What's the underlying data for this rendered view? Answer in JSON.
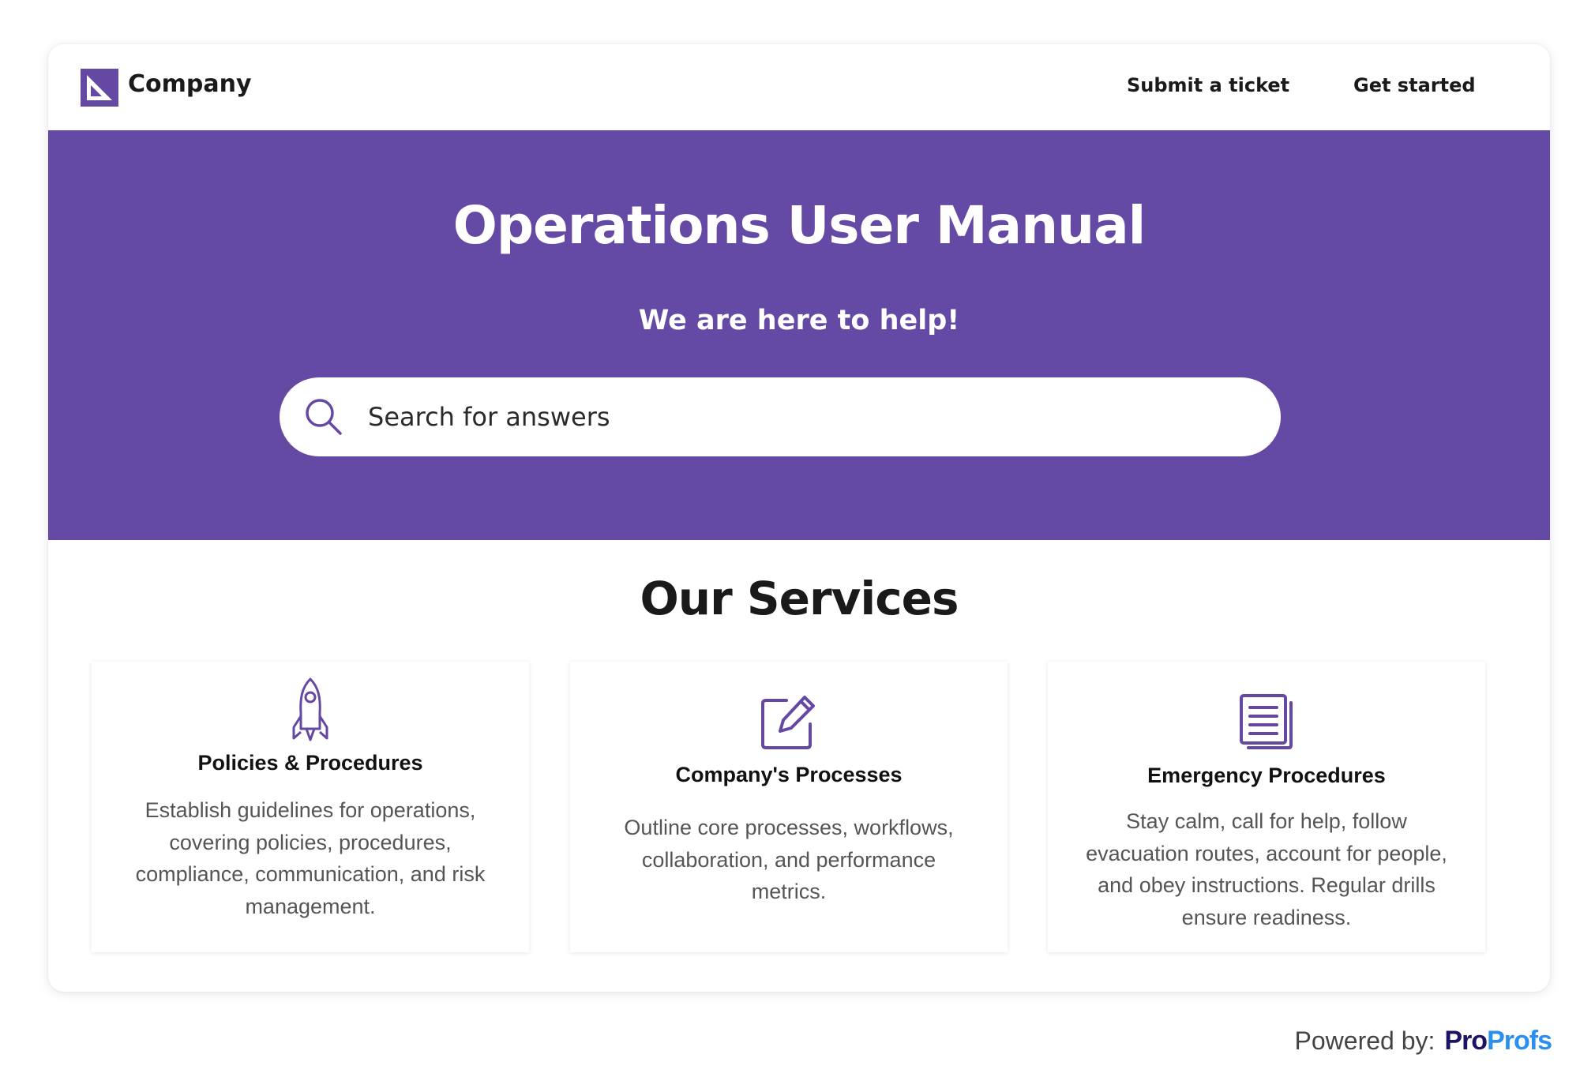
{
  "header": {
    "brand": "Company",
    "logo_icon": "company-logo-icon",
    "nav": [
      {
        "label": "Submit a ticket"
      },
      {
        "label": "Get started"
      }
    ]
  },
  "hero": {
    "title": "Operations User Manual",
    "subtitle": "We are here to help!",
    "search": {
      "placeholder": "Search for answers",
      "value": "",
      "icon": "search-icon"
    }
  },
  "services": {
    "title": "Our Services",
    "cards": [
      {
        "icon": "rocket-icon",
        "title": "Policies & Procedures",
        "description": "Establish guidelines for operations, covering policies, procedures, compliance, communication, and risk management."
      },
      {
        "icon": "edit-pencil-icon",
        "title": "Company's Processes",
        "description": "Outline core processes, workflows, collaboration, and performance metrics."
      },
      {
        "icon": "document-icon",
        "title": "Emergency Procedures",
        "description": "Stay calm, call for help, follow evacuation routes, account for people, and obey instructions. Regular drills ensure readiness."
      }
    ]
  },
  "footer": {
    "powered_label": "Powered by:",
    "brand_part1": "Pro",
    "brand_part2": "Profs"
  },
  "colors": {
    "accent": "#6449a5",
    "icon": "#6448a4",
    "brand_dark": "#1b1464",
    "brand_blue": "#2b8ff0"
  }
}
